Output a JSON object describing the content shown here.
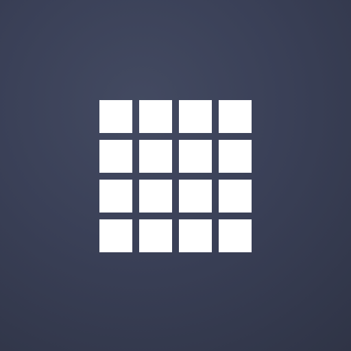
{
  "app": {
    "icon": "grid-icon",
    "background_color": "#3a4057",
    "foreground_color": "#ffffff"
  },
  "grid": {
    "rows": 4,
    "columns": 4
  }
}
